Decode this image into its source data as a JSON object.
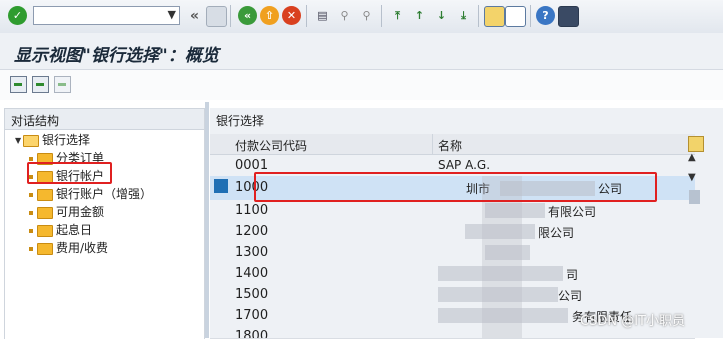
{
  "toolbar": {
    "command_field_value": "",
    "buttons": [
      {
        "name": "enter-icon"
      },
      {
        "name": "back-icon"
      },
      {
        "name": "save-icon"
      },
      {
        "name": "back-green-icon"
      },
      {
        "name": "exit-icon"
      },
      {
        "name": "cancel-icon"
      },
      {
        "name": "print-icon"
      },
      {
        "name": "find-icon"
      },
      {
        "name": "find-next-icon"
      },
      {
        "name": "first-page-icon"
      },
      {
        "name": "prev-page-icon"
      },
      {
        "name": "next-page-icon"
      },
      {
        "name": "last-page-icon"
      },
      {
        "name": "create-session-icon"
      },
      {
        "name": "shortcut-icon"
      },
      {
        "name": "help-icon"
      },
      {
        "name": "layout-icon"
      }
    ],
    "back_glyph": "«"
  },
  "title": "显示视图\"银行选择\"：概览",
  "tree": {
    "header": "对话结构",
    "root": "银行选择",
    "items": [
      "分类订单",
      "银行帐户",
      "银行账户（增强）",
      "可用金额",
      "起息日",
      "费用/收费"
    ]
  },
  "table": {
    "title": "银行选择",
    "columns": {
      "code": "付款公司代码",
      "name": "名称"
    },
    "rows": [
      {
        "code": "0001",
        "name": "SAP A.G."
      },
      {
        "code": "1000",
        "name": "圳市",
        "name_suffix": "公司",
        "selected": true
      },
      {
        "code": "1100",
        "name": "",
        "name_suffix": "有限公司"
      },
      {
        "code": "1200",
        "name": "",
        "name_suffix": "限公司"
      },
      {
        "code": "1300",
        "name": ""
      },
      {
        "code": "1400",
        "name": "",
        "name_suffix": "司"
      },
      {
        "code": "1500",
        "name": "",
        "name_suffix": "公司"
      },
      {
        "code": "1700",
        "name": "",
        "name_suffix": "务有限责任"
      },
      {
        "code": "1800",
        "name": ""
      }
    ]
  },
  "watermark": "CSDN @IT小职员",
  "colors": {
    "highlight": "#e02020",
    "selected_row": "#cfe2f5",
    "title_bg": "#eef1f5"
  }
}
